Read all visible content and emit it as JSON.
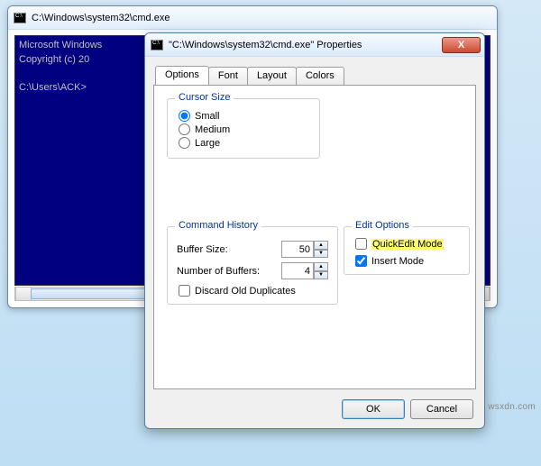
{
  "cmd": {
    "title": "C:\\Windows\\system32\\cmd.exe",
    "line1": "Microsoft Windows",
    "line2": "Copyright (c) 20",
    "prompt": "C:\\Users\\ACK>"
  },
  "props": {
    "title": "\"C:\\Windows\\system32\\cmd.exe\" Properties",
    "close_glyph": "X",
    "tabs": {
      "options": "Options",
      "font": "Font",
      "layout": "Layout",
      "colors": "Colors"
    },
    "cursor": {
      "legend": "Cursor Size",
      "small": "Small",
      "medium": "Medium",
      "large": "Large",
      "selected": "small"
    },
    "history": {
      "legend": "Command History",
      "buffer_label": "Buffer Size:",
      "buffer_value": "50",
      "numbuf_label": "Number of Buffers:",
      "numbuf_value": "4",
      "discard_label": "Discard Old Duplicates",
      "discard_checked": false
    },
    "edit": {
      "legend": "Edit Options",
      "quickedit_label": "QuickEdit Mode",
      "quickedit_checked": false,
      "insert_label": "Insert Mode",
      "insert_checked": true
    },
    "buttons": {
      "ok": "OK",
      "cancel": "Cancel"
    }
  },
  "watermark": "wsxdn.com"
}
